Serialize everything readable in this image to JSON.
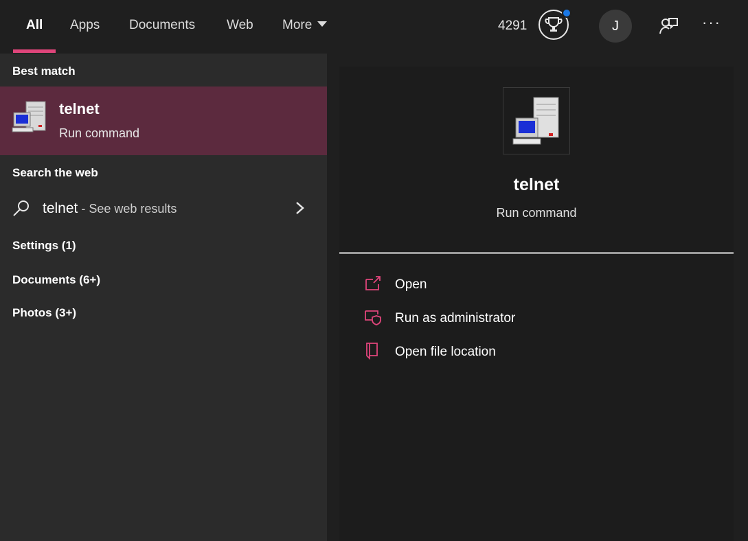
{
  "tabs": [
    {
      "label": "All",
      "active": true
    },
    {
      "label": "Apps"
    },
    {
      "label": "Documents"
    },
    {
      "label": "Web"
    },
    {
      "label": "More"
    }
  ],
  "topbar": {
    "points": "4291",
    "avatar_initial": "J",
    "more_options": "···"
  },
  "left": {
    "best_match_header": "Best match",
    "best_match": {
      "title": "telnet",
      "subtitle": "Run command"
    },
    "search_web_header": "Search the web",
    "web_result": {
      "query": "telnet",
      "suffix": " - See web results"
    },
    "categories": [
      "Settings (1)",
      "Documents (6+)",
      "Photos (3+)"
    ]
  },
  "right": {
    "title": "telnet",
    "subtitle": "Run command",
    "actions": [
      "Open",
      "Run as administrator",
      "Open file location"
    ]
  },
  "colors": {
    "accent": "#e0457b",
    "selection": "#5c2a3e",
    "notification": "#1a78e6"
  }
}
